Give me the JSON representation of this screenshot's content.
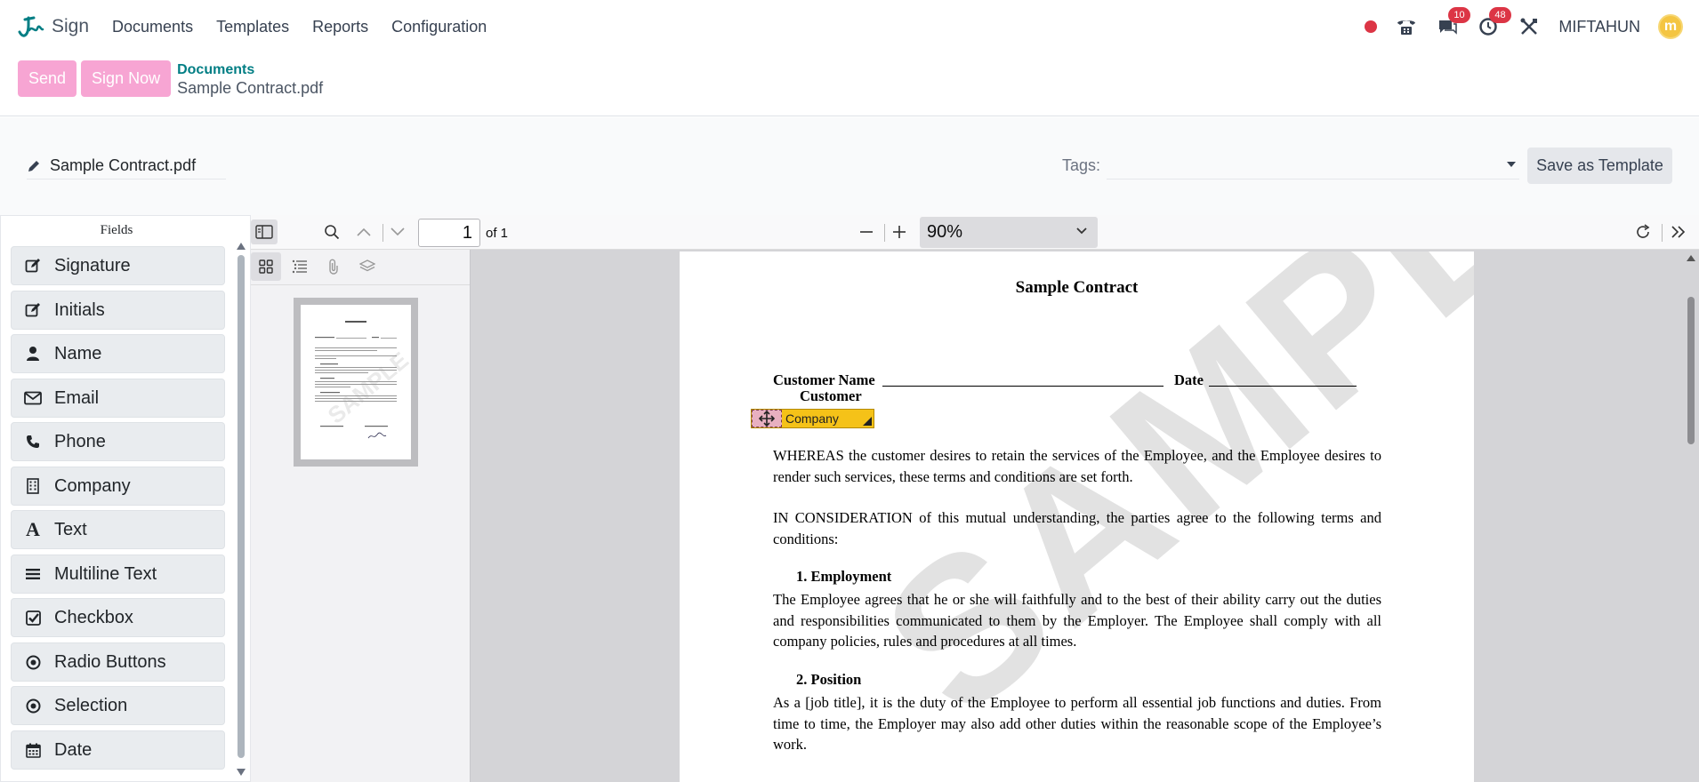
{
  "app": {
    "name": "Sign",
    "nav": [
      "Documents",
      "Templates",
      "Reports",
      "Configuration"
    ],
    "user": "MIFTAHUN",
    "avatar_initial": "m",
    "messages_count": "10",
    "activities_count": "48"
  },
  "controls": {
    "send_label": "Send",
    "sign_now_label": "Sign Now",
    "breadcrumb_parent": "Documents",
    "breadcrumb_current": "Sample Contract.pdf"
  },
  "form": {
    "filename": "Sample Contract.pdf",
    "tags_label": "Tags:",
    "save_template_label": "Save as Template"
  },
  "fields_panel": {
    "title": "Fields",
    "items": [
      {
        "label": "Signature",
        "icon": "edit-icon"
      },
      {
        "label": "Initials",
        "icon": "edit-icon"
      },
      {
        "label": "Name",
        "icon": "user-icon"
      },
      {
        "label": "Email",
        "icon": "envelope-icon"
      },
      {
        "label": "Phone",
        "icon": "phone-icon"
      },
      {
        "label": "Company",
        "icon": "building-icon"
      },
      {
        "label": "Text",
        "icon": "font-icon"
      },
      {
        "label": "Multiline Text",
        "icon": "bars-icon"
      },
      {
        "label": "Checkbox",
        "icon": "check-square-icon"
      },
      {
        "label": "Radio Buttons",
        "icon": "dot-circle-icon"
      },
      {
        "label": "Selection",
        "icon": "dot-circle-icon"
      },
      {
        "label": "Date",
        "icon": "calendar-icon"
      }
    ]
  },
  "viewer": {
    "page_number": "1",
    "page_of": "of 1",
    "zoom": "90%"
  },
  "document": {
    "title": "Sample Contract",
    "customer_name_label": "Customer Name",
    "date_label": "Date",
    "customer_label": "Customer",
    "placed_field": "Company",
    "watermark": "SAMPLE",
    "para1": "WHEREAS the customer desires to retain the services of the Employee, and the Employee desires to render such services, these terms and conditions are set forth.",
    "para2": "IN CONSIDERATION of this mutual understanding, the parties agree to the following terms and conditions:",
    "heading1": "1.   Employment",
    "para3": "The Employee agrees that he or she will faithfully and to the best of their ability carry out the duties and responsibilities communicated to them by the Employer. The Employee shall comply with all company policies, rules and procedures at all times.",
    "heading2": "2.   Position",
    "para4": "As a [job title], it is the duty of the Employee to perform all essential job functions and duties. From time to time, the Employer may also add other duties within the reasonable scope of the Employee’s work."
  },
  "colors": {
    "brand_teal": "#017e84",
    "button_pink": "#f7a5d3",
    "badge_red": "#dc3545",
    "field_yellow": "#f5c218"
  }
}
